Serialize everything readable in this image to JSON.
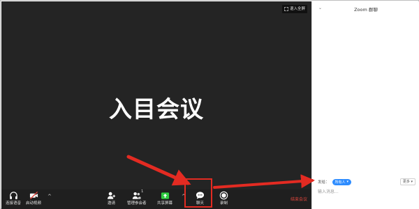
{
  "meeting": {
    "fullscreen_label": "退入全屏",
    "title_text": "入目会议"
  },
  "toolbar": {
    "audio_label": "连接语音",
    "video_label": "启动视频",
    "invite_label": "邀请",
    "participants_label": "管理参会者",
    "participants_count": "1",
    "share_label": "共享屏幕",
    "chat_label": "聊天",
    "record_label": "录制",
    "end_label": "结束会议"
  },
  "chat": {
    "title": "Zoom 群聊",
    "send_to_label": "发给：",
    "recipient": "所有人",
    "more_label": "更多",
    "input_placeholder": "输入消息..."
  },
  "colors": {
    "meeting_bg": "#242424",
    "toolbar_bg": "#1f1f1f",
    "accent_blue": "#2d8cff",
    "share_green": "#2ecc40",
    "end_red": "#e0453b",
    "annotation_red": "#e32b22"
  },
  "icons": [
    "headphones-icon",
    "video-off-icon",
    "invite-icon",
    "participants-icon",
    "share-screen-icon",
    "chat-icon",
    "record-icon",
    "fullscreen-icon"
  ]
}
